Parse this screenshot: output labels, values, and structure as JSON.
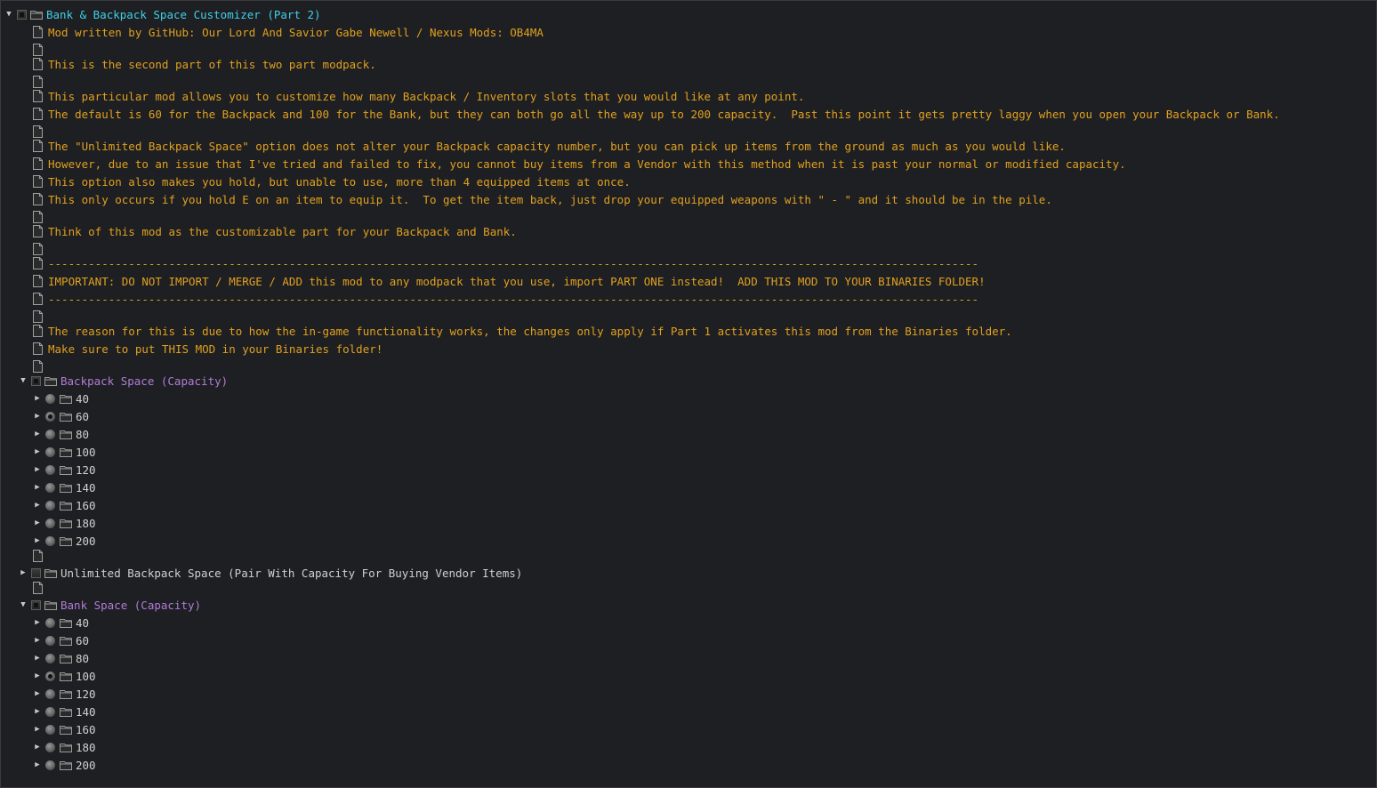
{
  "root": {
    "title": "Bank & Backpack Space Customizer (Part 2)",
    "lines": [
      "Mod written by GitHub: Our Lord And Savior Gabe Newell / Nexus Mods: OB4MA",
      "",
      "This is the second part of this two part modpack.",
      "",
      "This particular mod allows you to customize how many Backpack / Inventory slots that you would like at any point.",
      "The default is 60 for the Backpack and 100 for the Bank, but they can both go all the way up to 200 capacity.  Past this point it gets pretty laggy when you open your Backpack or Bank.",
      "",
      "The \"Unlimited Backpack Space\" option does not alter your Backpack capacity number, but you can pick up items from the ground as much as you would like.",
      "However, due to an issue that I've tried and failed to fix, you cannot buy items from a Vendor with this method when it is past your normal or modified capacity.",
      "This option also makes you hold, but unable to use, more than 4 equipped items at once.",
      "This only occurs if you hold E on an item to equip it.  To get the item back, just drop your equipped weapons with \" - \" and it should be in the pile.",
      "",
      "Think of this mod as the customizable part for your Backpack and Bank.",
      "",
      "-------------------------------------------------------------------------------------------------------------------------------------------",
      "IMPORTANT: DO NOT IMPORT / MERGE / ADD this mod to any modpack that you use, import PART ONE instead!  ADD THIS MOD TO YOUR BINARIES FOLDER!",
      "-------------------------------------------------------------------------------------------------------------------------------------------",
      "",
      "The reason for this is due to how the in-game functionality works, the changes only apply if Part 1 activates this mod from the Binaries folder.",
      "Make sure to put THIS MOD in your Binaries folder!",
      ""
    ]
  },
  "backpack": {
    "title": "Backpack Space (Capacity)",
    "options": [
      "40",
      "60",
      "80",
      "100",
      "120",
      "140",
      "160",
      "180",
      "200"
    ],
    "selected": "60"
  },
  "unlimited": {
    "title": "Unlimited Backpack Space (Pair With Capacity For Buying Vendor Items)"
  },
  "bank": {
    "title": "Bank Space (Capacity)",
    "options": [
      "40",
      "60",
      "80",
      "100",
      "120",
      "140",
      "160",
      "180",
      "200"
    ],
    "selected": "100"
  },
  "colors": {
    "background": "#1e1f22",
    "description": "#e0a020",
    "root_title": "#3fd0e8",
    "category": "#b07cd8",
    "plain": "#d0d0d0"
  },
  "icons": {
    "expanded": "triangle-down",
    "collapsed": "triangle-right",
    "folder": "folder-icon",
    "document": "document-icon"
  }
}
